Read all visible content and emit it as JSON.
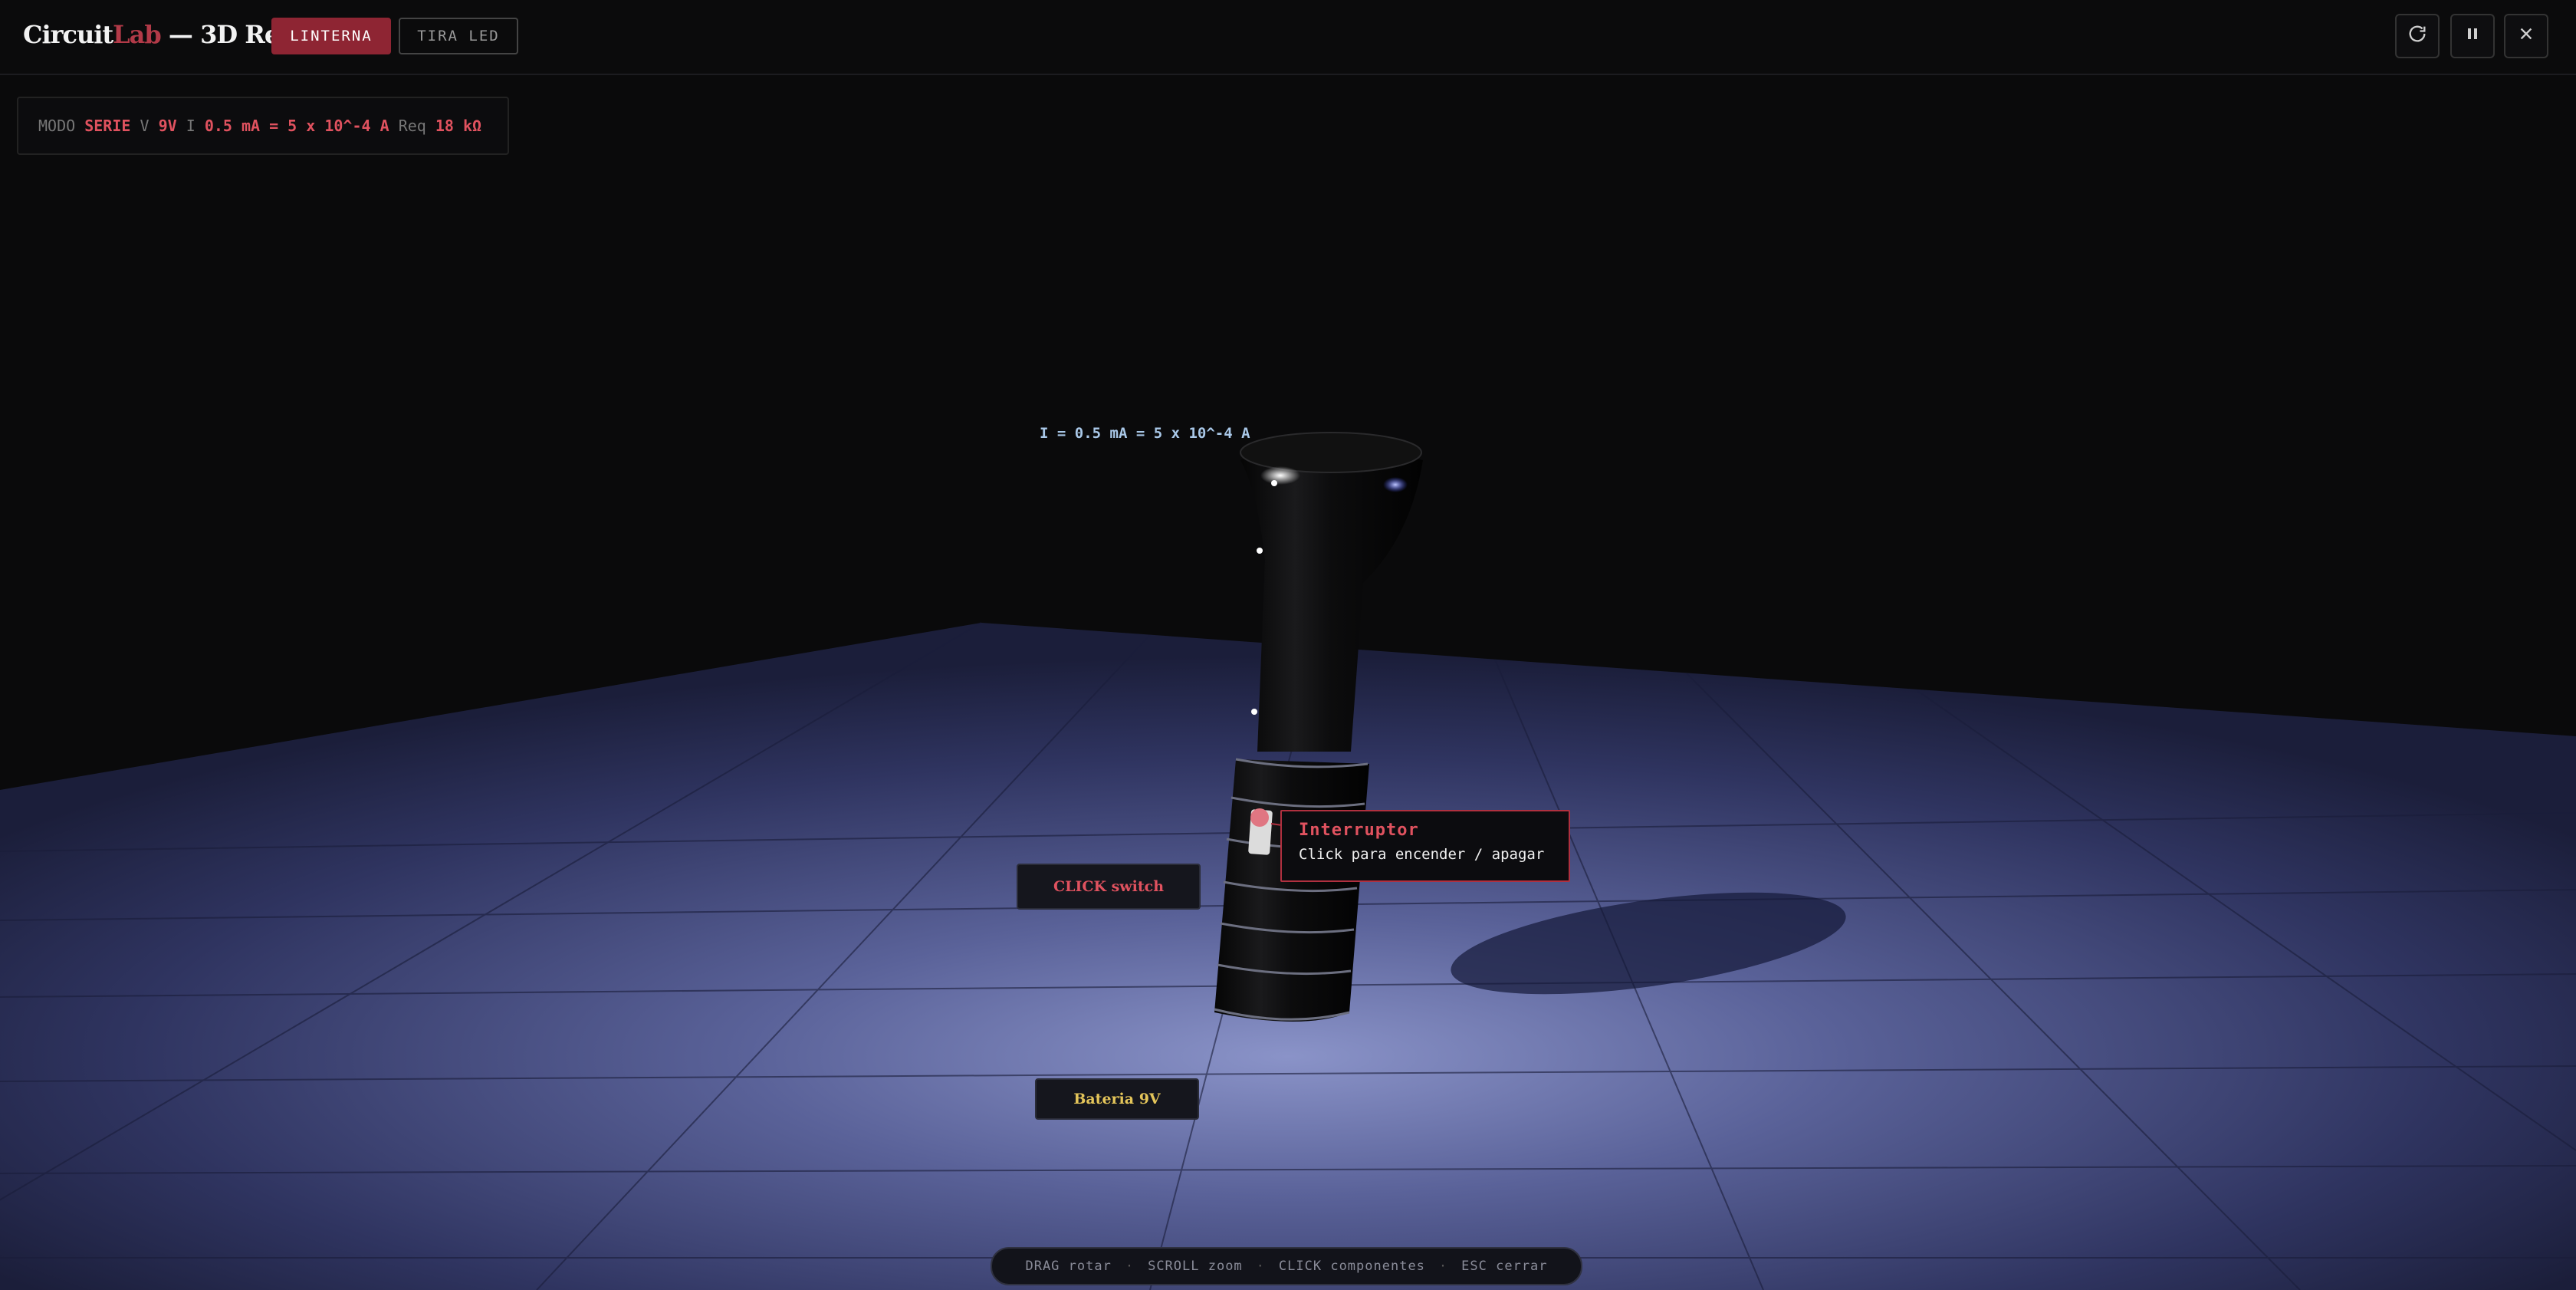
{
  "header": {
    "brand_a": "Circuit",
    "brand_b": "Lab",
    "brand_c": " — 3D Real",
    "tab_linterna": "LINTERNA",
    "tab_tira_led": "TIRA LED",
    "icons": [
      "refresh-icon",
      "pause-icon",
      "close-icon"
    ]
  },
  "readout": {
    "mode_key": "MODO",
    "mode_val": "SERIE",
    "v_key": "V",
    "v_val": "9V",
    "i_key": "I",
    "i_val": "0.5 mA = 5 x 10^-4 A",
    "req_key": "Req",
    "req_val": "18 kΩ"
  },
  "scene": {
    "current_label": "I = 0.5 mA = 5 x 10^-4 A",
    "click_chip": "CLICK switch",
    "battery_chip": "Bateria 9V",
    "tooltip_title": "Interruptor",
    "tooltip_body": "Click para encender / apagar"
  },
  "footer": {
    "hint_drag": "DRAG rotar",
    "hint_scroll": "SCROLL zoom",
    "hint_click": "CLICK componentes",
    "hint_esc": "ESC cerrar",
    "separator": "·"
  },
  "colors": {
    "accent": "#8e2533",
    "value": "#e0525f",
    "battery": "#e4c55a",
    "floor": "#3d4370"
  }
}
